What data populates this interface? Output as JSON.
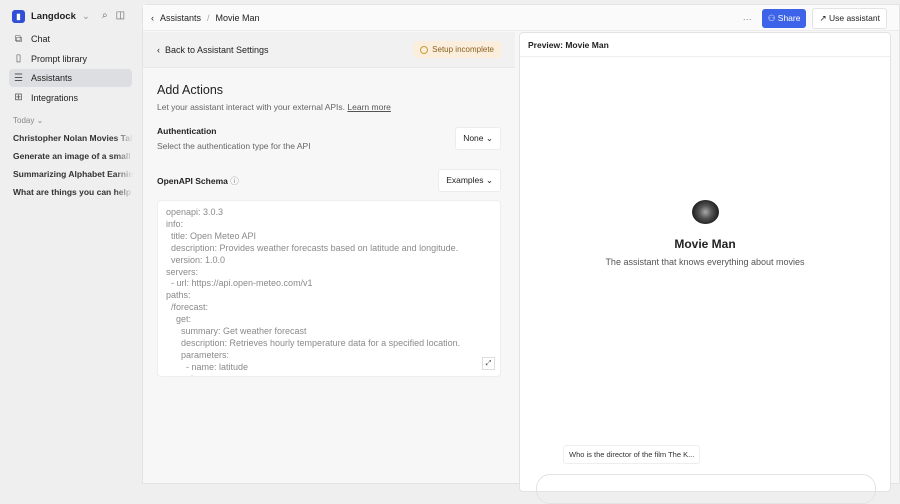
{
  "sidebar": {
    "brand": "Langdock",
    "nav": [
      {
        "label": "Chat",
        "icon": "chat-icon"
      },
      {
        "label": "Prompt library",
        "icon": "book-icon"
      },
      {
        "label": "Assistants",
        "icon": "assistant-icon"
      },
      {
        "label": "Integrations",
        "icon": "integrations-icon"
      }
    ],
    "today": "Today",
    "history": [
      "Christopher Nolan Movies Table",
      "Generate an image of a small bird",
      "Summarizing Alphabet Earnings",
      "What are things you can help me with"
    ]
  },
  "topbar": {
    "crumb1": "Assistants",
    "crumb2": "Movie Man",
    "share": "Share",
    "use": "Use assistant"
  },
  "left": {
    "back": "Back to Assistant Settings",
    "badge": "Setup incomplete",
    "title": "Add Actions",
    "subtitle": "Let your assistant interact with your external APIs.",
    "learn_more": "Learn more",
    "auth_label": "Authentication",
    "auth_desc": "Select the authentication type for the API",
    "auth_value": "None",
    "schema_label": "OpenAPI Schema",
    "examples": "Examples",
    "code": "openapi: 3.0.3\ninfo:\n  title: Open Meteo API\n  description: Provides weather forecasts based on latitude and longitude.\n  version: 1.0.0\nservers:\n  - url: https://api.open-meteo.com/v1\npaths:\n  /forecast:\n    get:\n      summary: Get weather forecast\n      description: Retrieves hourly temperature data for a specified location.\n      parameters:\n        - name: latitude\n          in: query"
  },
  "preview": {
    "title": "Preview: Movie Man",
    "name": "Movie Man",
    "description": "The assistant that knows everything about movies",
    "suggestion": "Who is the director of the film The K..."
  }
}
